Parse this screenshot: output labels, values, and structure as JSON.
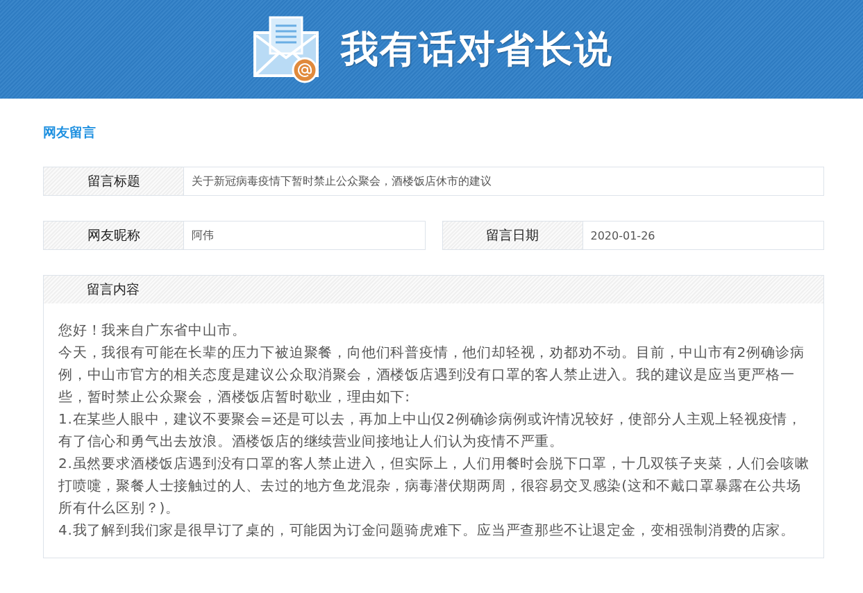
{
  "banner": {
    "title": "我有话对省长说"
  },
  "section_title": "网友留言",
  "fields": [
    {
      "label": "留言标题",
      "value": "关于新冠病毒疫情下暂时禁止公众聚会，酒楼饭店休市的建议",
      "kind": "full"
    },
    {
      "label": "网友昵称",
      "value": "阿伟",
      "kind": "half"
    },
    {
      "label": "留言日期",
      "value": "2020-01-26",
      "kind": "half"
    }
  ],
  "content": {
    "label": "留言内容",
    "paragraphs": [
      "您好！我来自广东省中山市。",
      "今天，我很有可能在长辈的压力下被迫聚餐，向他们科普疫情，他们却轻视，劝都劝不动。目前，中山市有2例确诊病例，中山市官方的相关态度是建议公众取消聚会，酒楼饭店遇到没有口罩的客人禁止进入。我的建议是应当更严格一些，暂时禁止公众聚会，酒楼饭店暂时歇业，理由如下:",
      "1.在某些人眼中，建议不要聚会=还是可以去，再加上中山仅2例确诊病例或许情况较好，使部分人主观上轻视疫情，有了信心和勇气出去放浪。酒楼饭店的继续营业间接地让人们认为疫情不严重。",
      "2.虽然要求酒楼饭店遇到没有口罩的客人禁止进入，但实际上，人们用餐时会脱下口罩，十几双筷子夹菜，人们会咳嗽打喷嚏，聚餐人士接触过的人、去过的地方鱼龙混杂，病毒潜伏期两周，很容易交叉感染(这和不戴口罩暴露在公共场所有什么区别？)。",
      "4.我了解到我们家是很早订了桌的，可能因为订金问题骑虎难下。应当严查那些不让退定金，变相强制消费的店家。"
    ]
  }
}
